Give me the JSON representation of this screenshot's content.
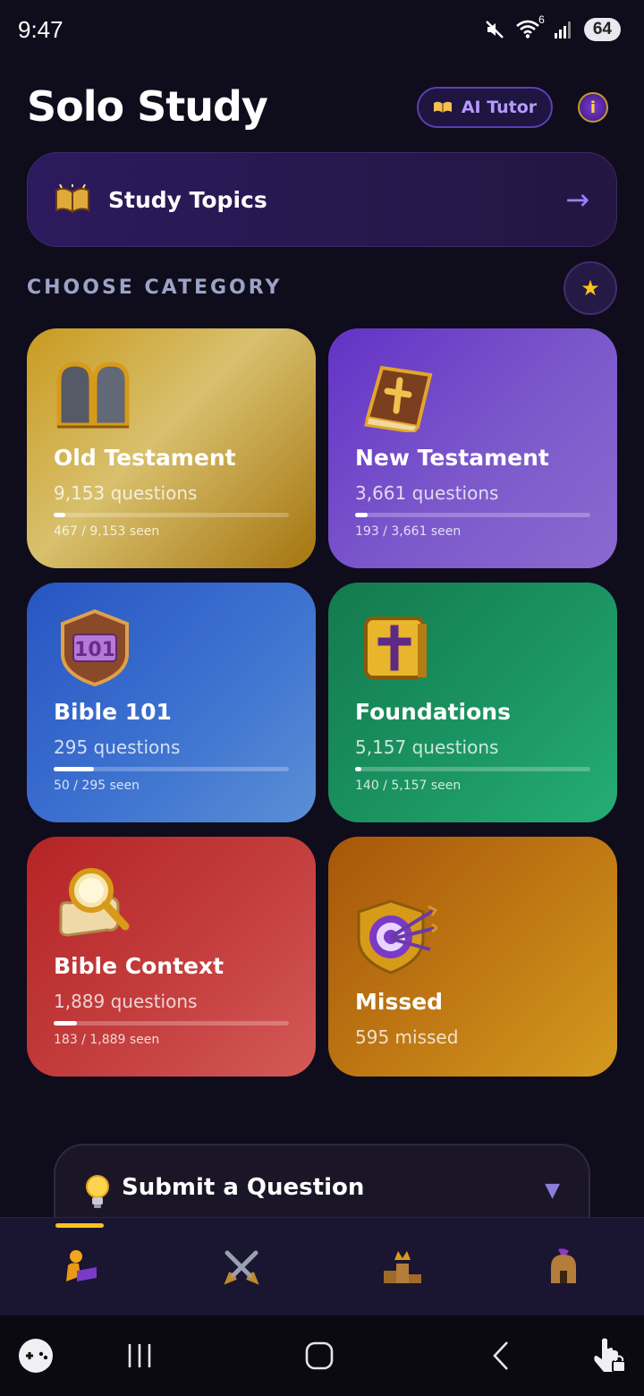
{
  "status": {
    "time": "9:47",
    "network": "6",
    "battery": "64"
  },
  "header": {
    "title": "Solo Study",
    "ai_tutor_label": "AI Tutor",
    "info_symbol": "i"
  },
  "topics": {
    "label": "Study Topics",
    "arrow": "→"
  },
  "section": {
    "label": "CHOOSE CATEGORY",
    "favorites_symbol": "★"
  },
  "categories": [
    {
      "title": "Old Testament",
      "count": "9,153 questions",
      "seen": "467 / 9,153 seen",
      "progress": 0.051,
      "icon": "stone-tablets-icon"
    },
    {
      "title": "New Testament",
      "count": "3,661 questions",
      "seen": "193 / 3,661 seen",
      "progress": 0.053,
      "icon": "bible-book-icon"
    },
    {
      "title": "Bible 101",
      "count": "295 questions",
      "seen": "50 / 295 seen",
      "progress": 0.17,
      "icon": "shield-101-icon",
      "badge": "101"
    },
    {
      "title": "Foundations",
      "count": "5,157 questions",
      "seen": "140 / 5,157 seen",
      "progress": 0.027,
      "icon": "cross-block-icon"
    },
    {
      "title": "Bible Context",
      "count": "1,889 questions",
      "seen": "183 / 1,889 seen",
      "progress": 0.097,
      "icon": "magnifier-scroll-icon"
    },
    {
      "title": "Missed",
      "count": "595 missed",
      "icon": "target-arrows-icon"
    }
  ],
  "submit": {
    "label": "Submit a Question",
    "chevron": "▼"
  },
  "tabs": [
    {
      "name": "solo-study",
      "icon": "reading-person-icon",
      "active": true
    },
    {
      "name": "battle",
      "icon": "crossed-swords-icon",
      "active": false
    },
    {
      "name": "leaderboard",
      "icon": "crown-podium-icon",
      "active": false
    },
    {
      "name": "profile",
      "icon": "spartan-helmet-icon",
      "active": false
    }
  ],
  "colors": {
    "accent": "#ffc21a",
    "purple": "#9d7dff",
    "background": "#0f0c1c"
  }
}
